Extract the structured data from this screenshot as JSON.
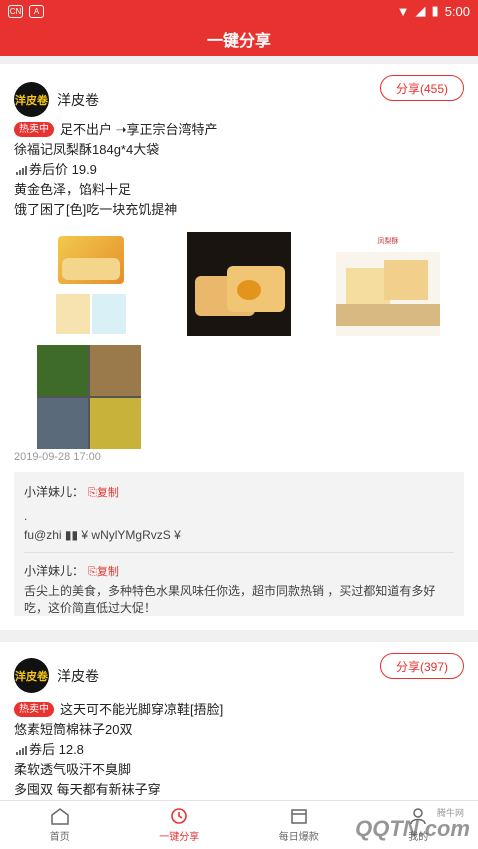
{
  "statusbar": {
    "chip1": "CN",
    "chip2": "A",
    "time": "5:00"
  },
  "header": {
    "title": "一键分享"
  },
  "posts": [
    {
      "author": "洋皮卷",
      "avatar_text": "洋皮卷",
      "share_label": "分享(455)",
      "badge": "热卖中",
      "lines": [
        "足不出户 ➝享正宗台湾特产",
        "徐福记凤梨酥184g*4大袋",
        "券后价 19.9",
        "黄金色泽，馅料十足",
        "饿了困了[色]吃一块充饥提神"
      ],
      "images": [
        "凤梨酥",
        "凤梨酥切面",
        "凤梨酥特写",
        "凤梨酥拼图"
      ],
      "img_caption": "凤梨酥",
      "date": "2019-09-28 17:00",
      "comments": [
        {
          "name": "小洋妹儿：",
          "copy": "复制",
          "text1": ".",
          "text2": "fu@zhi ▮▮ ¥ wNylYMgRvzS ¥"
        },
        {
          "name": "小洋妹儿：",
          "copy": "复制",
          "text1": "舌尖上的美食，多种特色水果风味任你选，超市同款热销 ，买过都知道有多好吃，这价简直低过大促！"
        }
      ]
    },
    {
      "author": "洋皮卷",
      "avatar_text": "洋皮卷",
      "share_label": "分享(397)",
      "badge": "热卖中",
      "lines": [
        "这天可不能光脚穿凉鞋[捂脸]",
        "悠素短筒棉袜子20双",
        "券后 12.8",
        "柔软透气吸汗不臭脚",
        "多囤双 每天都有新袜子穿"
      ]
    }
  ],
  "tabs": [
    {
      "label": "首页",
      "icon": "home-icon"
    },
    {
      "label": "一键分享",
      "icon": "share-icon",
      "active": true
    },
    {
      "label": "每日爆款",
      "icon": "calendar-icon"
    },
    {
      "label": "我的",
      "icon": "user-icon"
    }
  ],
  "watermark": {
    "main": "QQTN.com",
    "small": "腾牛网"
  }
}
